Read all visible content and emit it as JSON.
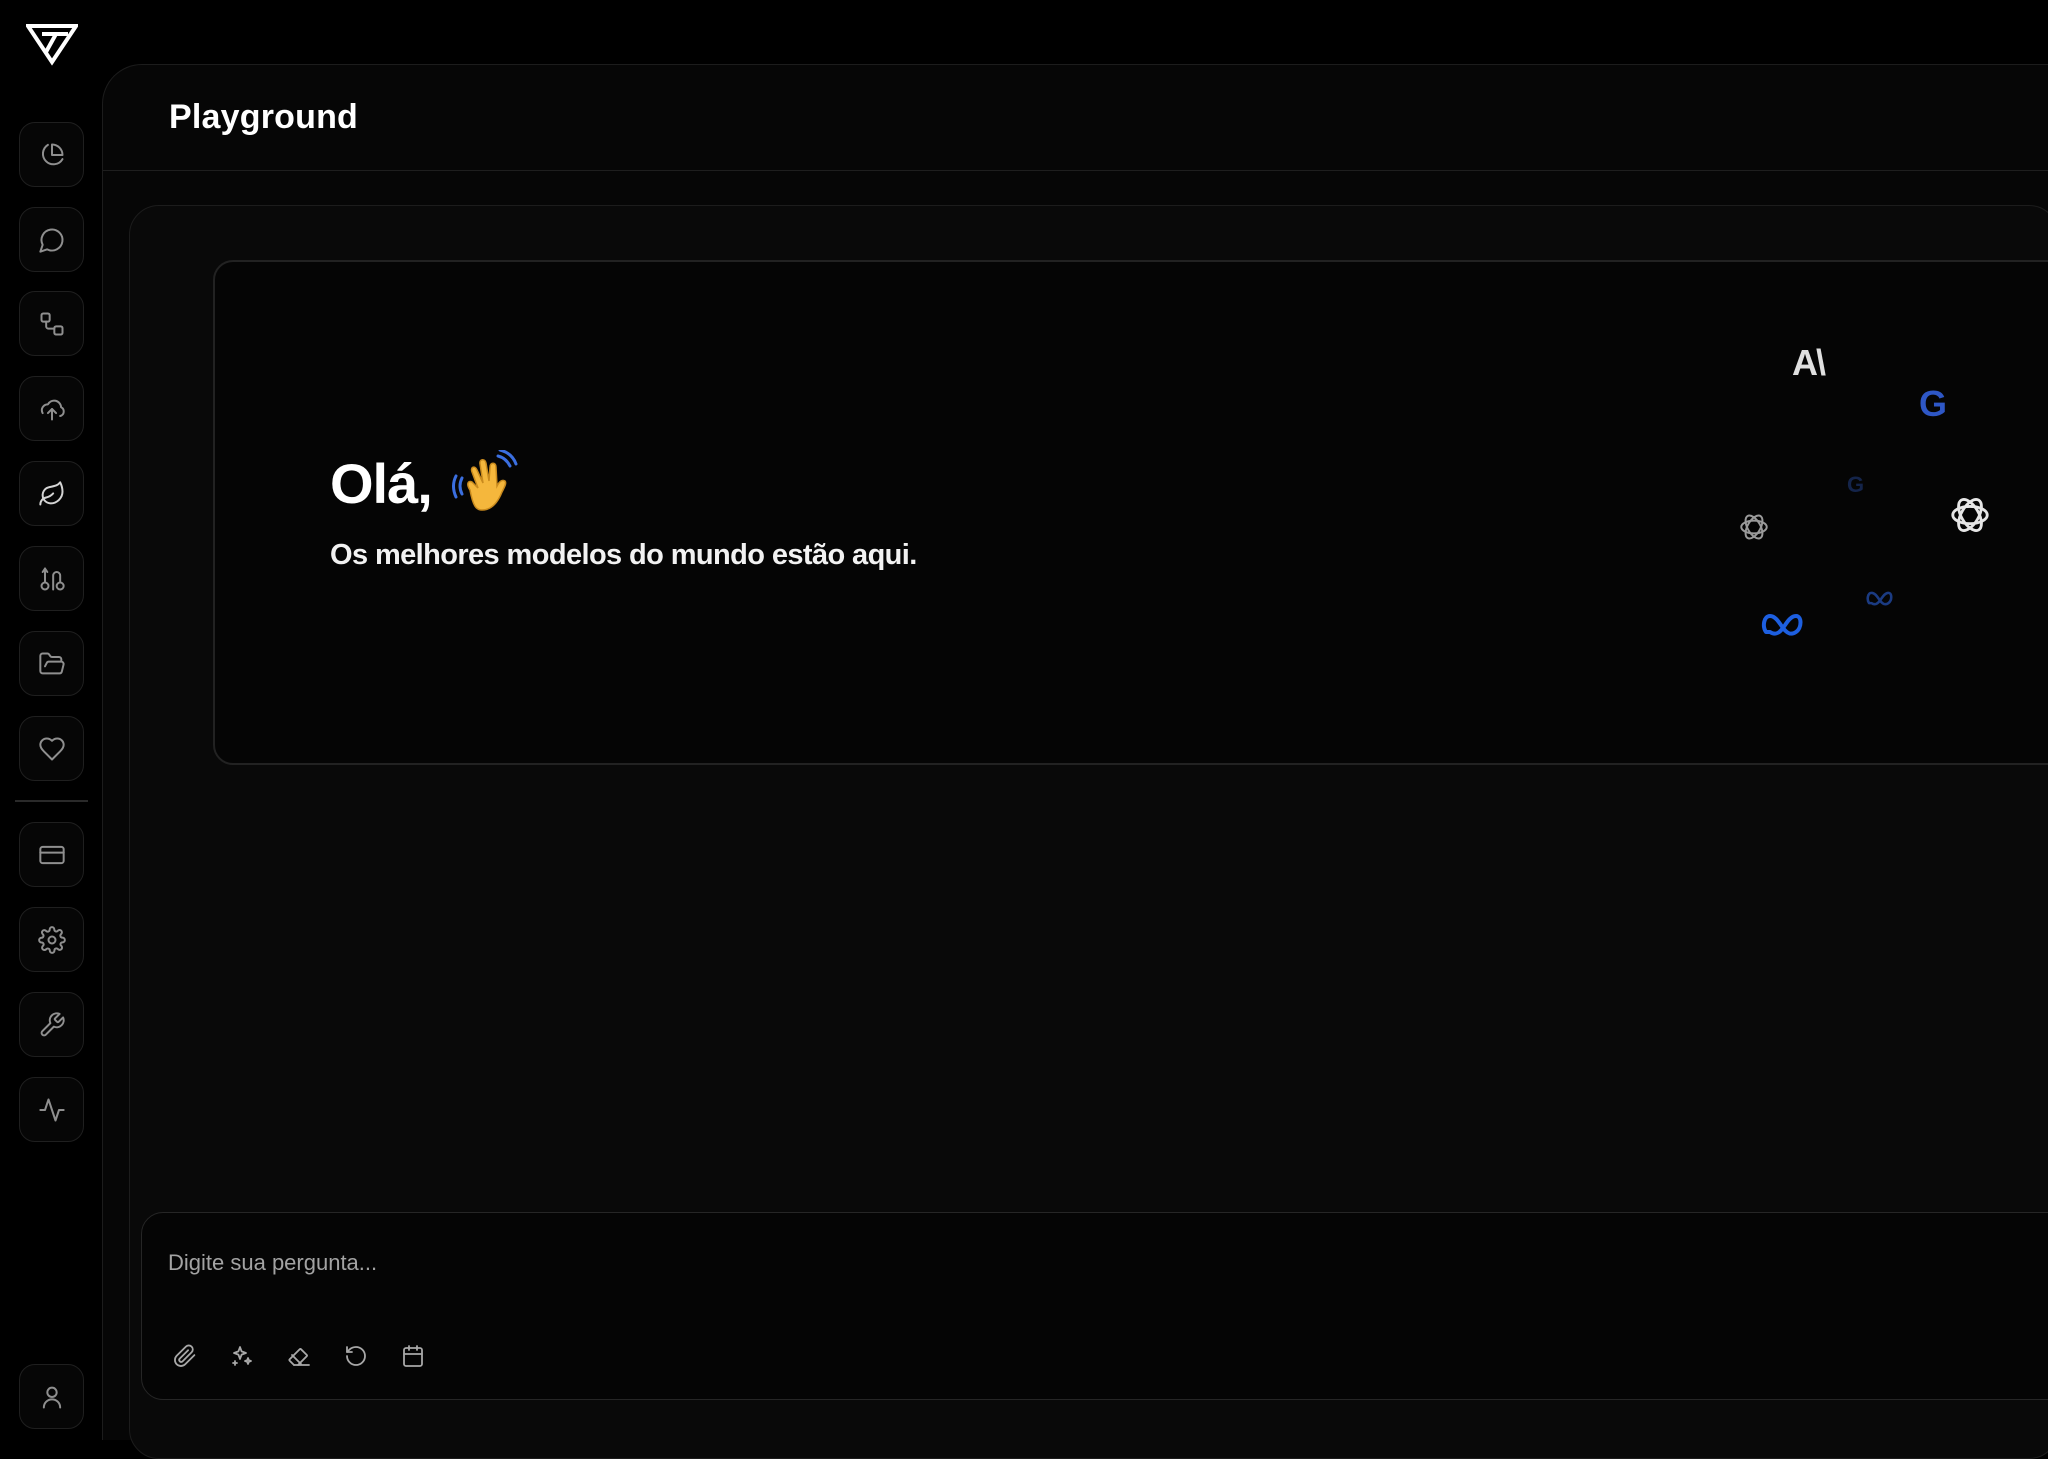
{
  "app": {
    "logo": "brand-v-logo"
  },
  "sidebar": {
    "items": [
      {
        "name": "analytics",
        "icon": "pie-chart-icon"
      },
      {
        "name": "chat",
        "icon": "chat-bubble-icon"
      },
      {
        "name": "workflows",
        "icon": "flow-icon"
      },
      {
        "name": "upload",
        "icon": "cloud-upload-icon"
      },
      {
        "name": "playground",
        "icon": "leaf-icon",
        "active": true
      },
      {
        "name": "routing",
        "icon": "route-icon"
      },
      {
        "name": "files",
        "icon": "folder-open-icon"
      },
      {
        "name": "favorites",
        "icon": "heart-icon"
      },
      {
        "name": "billing",
        "icon": "credit-card-icon"
      },
      {
        "name": "settings",
        "icon": "gear-icon"
      },
      {
        "name": "tools",
        "icon": "wrench-icon"
      },
      {
        "name": "activity",
        "icon": "pulse-icon"
      },
      {
        "name": "profile",
        "icon": "user-icon"
      }
    ]
  },
  "header": {
    "title": "Playground"
  },
  "hero": {
    "greeting": "Olá,",
    "subtitle": "Os melhores modelos do mundo estão aqui.",
    "logos": {
      "anthropic": "A\\",
      "google": "G"
    }
  },
  "composer": {
    "placeholder": "Digite sua pergunta...",
    "tools": [
      "paperclip-icon",
      "sparkles-icon",
      "eraser-icon",
      "refresh-icon",
      "calendar-icon"
    ]
  },
  "colors": {
    "background": "#000000",
    "panel": "#060606",
    "google_blue": "#2e57c6",
    "meta_blue": "#1d5fe0"
  }
}
